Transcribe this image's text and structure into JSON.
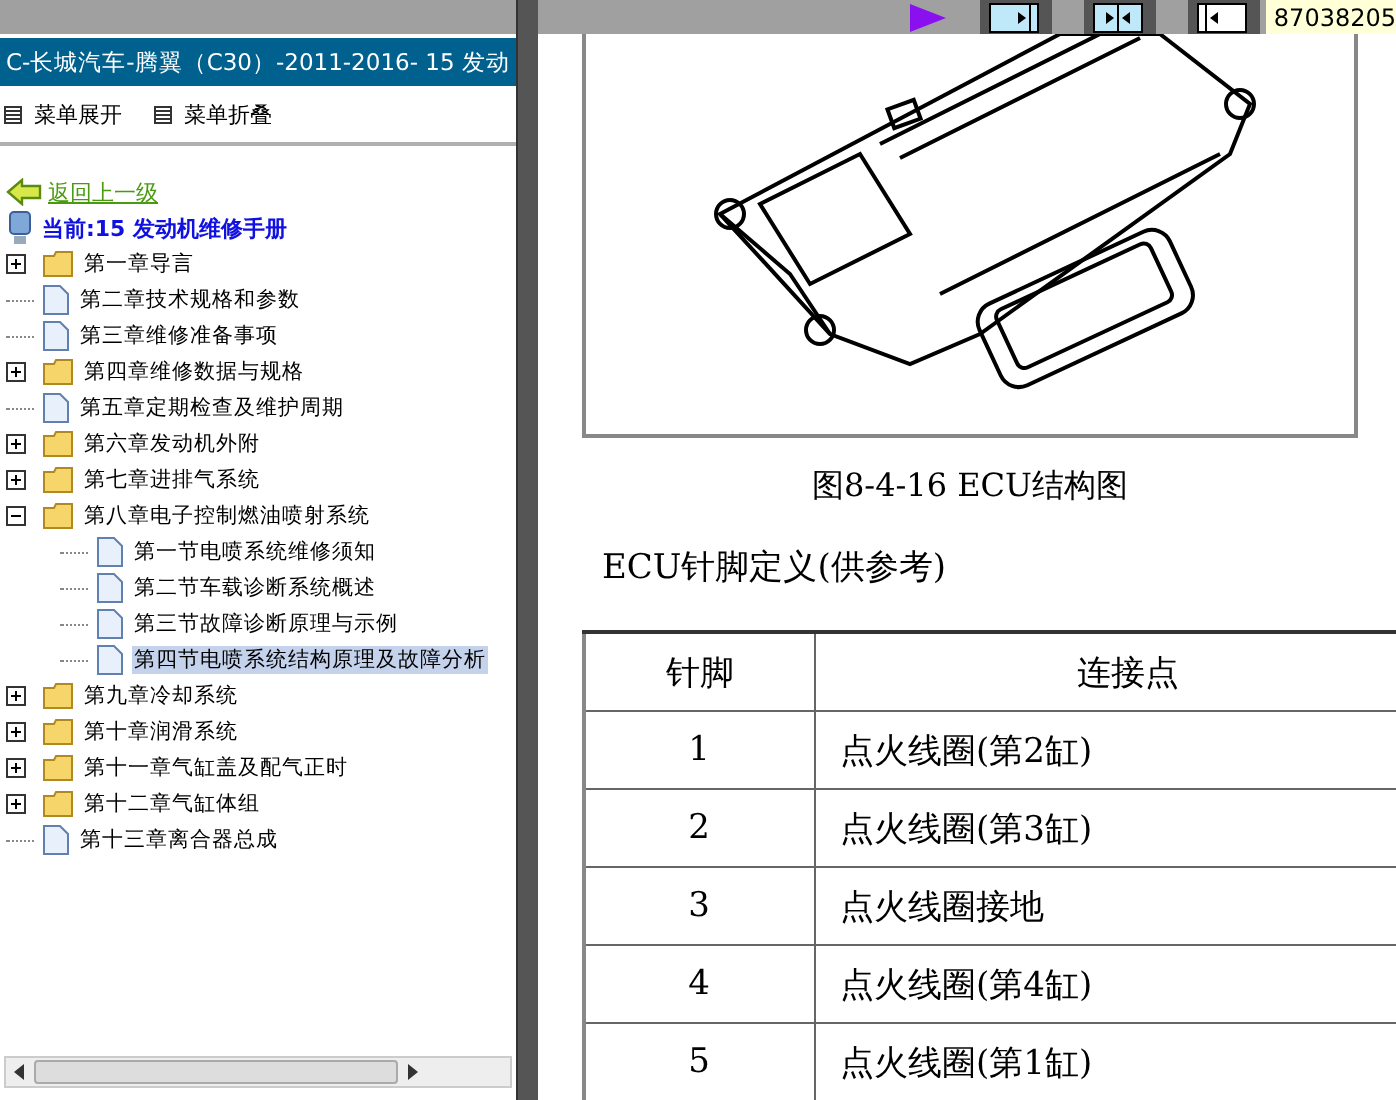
{
  "left_panel": {
    "title": "C-长城汽车-腾翼（C30）-2011-2016- 15 发动",
    "menu_buttons": [
      {
        "label": "菜单展开"
      },
      {
        "label": "菜单折叠"
      }
    ],
    "back_link": "返回上一级",
    "current": "当前:15 发动机维修手册",
    "tree": [
      {
        "label": "第一章导言",
        "kind": "folder",
        "expanded": false,
        "selected": false
      },
      {
        "label": "第二章技术规格和参数",
        "kind": "page",
        "selected": false
      },
      {
        "label": "第三章维修准备事项",
        "kind": "page",
        "selected": false
      },
      {
        "label": "第四章维修数据与规格",
        "kind": "folder",
        "expanded": false,
        "selected": false
      },
      {
        "label": "第五章定期检查及维护周期",
        "kind": "page",
        "selected": false
      },
      {
        "label": "第六章发动机外附",
        "kind": "folder",
        "expanded": false,
        "selected": false
      },
      {
        "label": "第七章进排气系统",
        "kind": "folder",
        "expanded": false,
        "selected": false
      },
      {
        "label": "第八章电子控制燃油喷射系统",
        "kind": "folder",
        "expanded": true,
        "selected": false,
        "children": [
          {
            "label": "第一节电喷系统维修须知",
            "kind": "page",
            "selected": false
          },
          {
            "label": "第二节车载诊断系统概述",
            "kind": "page",
            "selected": false
          },
          {
            "label": "第三节故障诊断原理与示例",
            "kind": "page",
            "selected": false
          },
          {
            "label": "第四节电喷系统结构原理及故障分析",
            "kind": "page",
            "selected": true
          }
        ]
      },
      {
        "label": "第九章冷却系统",
        "kind": "folder",
        "expanded": false,
        "selected": false
      },
      {
        "label": "第十章润滑系统",
        "kind": "folder",
        "expanded": false,
        "selected": false
      },
      {
        "label": "第十一章气缸盖及配气正时",
        "kind": "folder",
        "expanded": false,
        "selected": false
      },
      {
        "label": "第十二章气缸体组",
        "kind": "folder",
        "expanded": false,
        "selected": false
      },
      {
        "label": "第十三章离合器总成",
        "kind": "page",
        "selected": false
      }
    ]
  },
  "top_bar": {
    "page_number": "87038205"
  },
  "document": {
    "figure_caption": "图8-4-16 ECU结构图",
    "section_title": "ECU针脚定义(供参考)",
    "table": {
      "columns": [
        "针脚",
        "连接点"
      ],
      "rows": [
        [
          "1",
          "点火线圈(第2缸)"
        ],
        [
          "2",
          "点火线圈(第3缸)"
        ],
        [
          "3",
          "点火线圈接地"
        ],
        [
          "4",
          "点火线圈(第4缸)"
        ],
        [
          "5",
          "点火线圈(第1缸)"
        ]
      ]
    }
  }
}
